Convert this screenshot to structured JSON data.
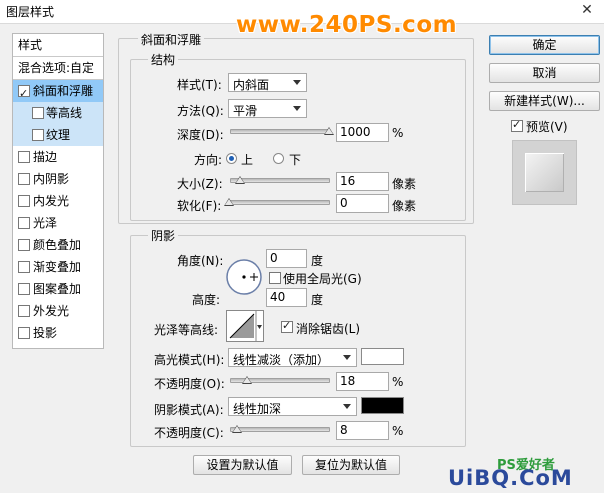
{
  "window": {
    "title": "图层样式",
    "close_glyph": "✕",
    "watermark": "www.240PS.com"
  },
  "left_list": {
    "header": "样式",
    "blend_options": "混合选项:自定",
    "items": [
      {
        "label": "斜面和浮雕",
        "checked": true
      },
      {
        "label": "等高线",
        "checked": false
      },
      {
        "label": "纹理",
        "checked": false
      },
      {
        "label": "描边",
        "checked": false
      },
      {
        "label": "内阴影",
        "checked": false
      },
      {
        "label": "内发光",
        "checked": false
      },
      {
        "label": "光泽",
        "checked": false
      },
      {
        "label": "颜色叠加",
        "checked": false
      },
      {
        "label": "渐变叠加",
        "checked": false
      },
      {
        "label": "图案叠加",
        "checked": false
      },
      {
        "label": "外发光",
        "checked": false
      },
      {
        "label": "投影",
        "checked": false
      }
    ]
  },
  "bevel": {
    "group_title": "斜面和浮雕",
    "structure_title": "结构",
    "style_label": "样式(T):",
    "style_value": "内斜面",
    "technique_label": "方法(Q):",
    "technique_value": "平滑",
    "depth_label": "深度(D):",
    "depth_value": "1000",
    "depth_unit": "%",
    "depth_slider": 1.0,
    "direction_label": "方向:",
    "dir_up": "上",
    "dir_down": "下",
    "size_label": "大小(Z):",
    "size_value": "16",
    "size_unit": "像素",
    "size_slider": 0.1,
    "soften_label": "软化(F):",
    "soften_value": "0",
    "soften_unit": "像素",
    "soften_slider": 0.0
  },
  "shading": {
    "group_title": "阴影",
    "angle_label": "角度(N):",
    "angle_value": "0",
    "angle_unit": "度",
    "global_light_label": "使用全局光(G)",
    "altitude_label": "高度:",
    "altitude_value": "40",
    "altitude_unit": "度",
    "gloss_label": "光泽等高线:",
    "antialias_label": "消除锯齿(L)",
    "highlight_mode_label": "高光模式(H):",
    "highlight_mode_value": "线性减淡（添加）",
    "highlight_color": "#ffffff",
    "highlight_opacity_label": "不透明度(O):",
    "highlight_opacity_value": "18",
    "highlight_opacity_unit": "%",
    "highlight_opacity_slider": 0.18,
    "shadow_mode_label": "阴影模式(A):",
    "shadow_mode_value": "线性加深",
    "shadow_color": "#000000",
    "shadow_opacity_label": "不透明度(C):",
    "shadow_opacity_value": "8",
    "shadow_opacity_unit": "%",
    "shadow_opacity_slider": 0.08
  },
  "buttons": {
    "ok": "确定",
    "cancel": "取消",
    "new_style": "新建样式(W)...",
    "preview": "预览(V)",
    "make_default": "设置为默认值",
    "reset_default": "复位为默认值"
  },
  "footer": {
    "site_logo": "PS爱好者",
    "brand": "UiBQ.CoM"
  }
}
